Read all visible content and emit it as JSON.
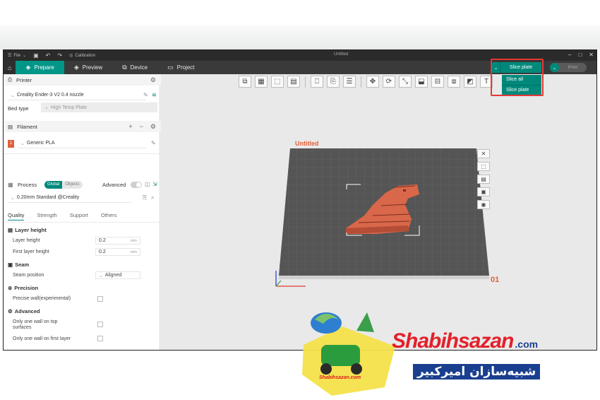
{
  "titlebar": {
    "menu_label": "File",
    "calibration_label": "Calibration",
    "window_title": "Untitled"
  },
  "tabs": [
    {
      "label": "Prepare"
    },
    {
      "label": "Preview"
    },
    {
      "label": "Device"
    },
    {
      "label": "Project"
    }
  ],
  "slice": {
    "button_label": "Slice plate",
    "print_label": "Print",
    "menu": [
      "Slice all",
      "Slice plate"
    ]
  },
  "printer": {
    "section_label": "Printer",
    "name": "Creality Ender-3 V2 0.4 nozzle",
    "bed_type_label": "Bed type",
    "bed_type_value": "High Temp Plate"
  },
  "filament": {
    "section_label": "Filament",
    "index": "1",
    "name": "Generic PLA"
  },
  "process": {
    "section_label": "Process",
    "global_label": "Global",
    "objects_label": "Objects",
    "advanced_label": "Advanced",
    "preset": "0.20mm Standard @Creality"
  },
  "subtabs": [
    "Quality",
    "Strength",
    "Support",
    "Others"
  ],
  "quality": {
    "layer_height_group": "Layer height",
    "layer_height_label": "Layer height",
    "layer_height_value": "0.2",
    "first_layer_label": "First layer height",
    "first_layer_value": "0.2",
    "unit": "mm",
    "seam_group": "Seam",
    "seam_position_label": "Seam position",
    "seam_position_value": "Aligned",
    "precision_group": "Precision",
    "precise_wall_label": "Precise wall(experimental)",
    "advanced_group": "Advanced",
    "one_wall_top_label_1": "Only one wall on top",
    "one_wall_top_label_2": "surfaces",
    "one_wall_first_label": "Only one wall on first layer"
  },
  "viewport": {
    "plate_name": "Untitled",
    "plate_number": "01",
    "bed_color": "#555555",
    "model_color": "#d9674a"
  },
  "watermark": {
    "brand_latin": "Shabihsazan",
    "brand_tld": ".com",
    "brand_persian": "شبیه‌سازان امیرکبیر",
    "badge_text": "Shabihsazan.com"
  },
  "colors": {
    "accent": "#00897b",
    "highlight": "#e53935",
    "brand_red": "#e3202a",
    "brand_blue": "#1a3f8f"
  }
}
